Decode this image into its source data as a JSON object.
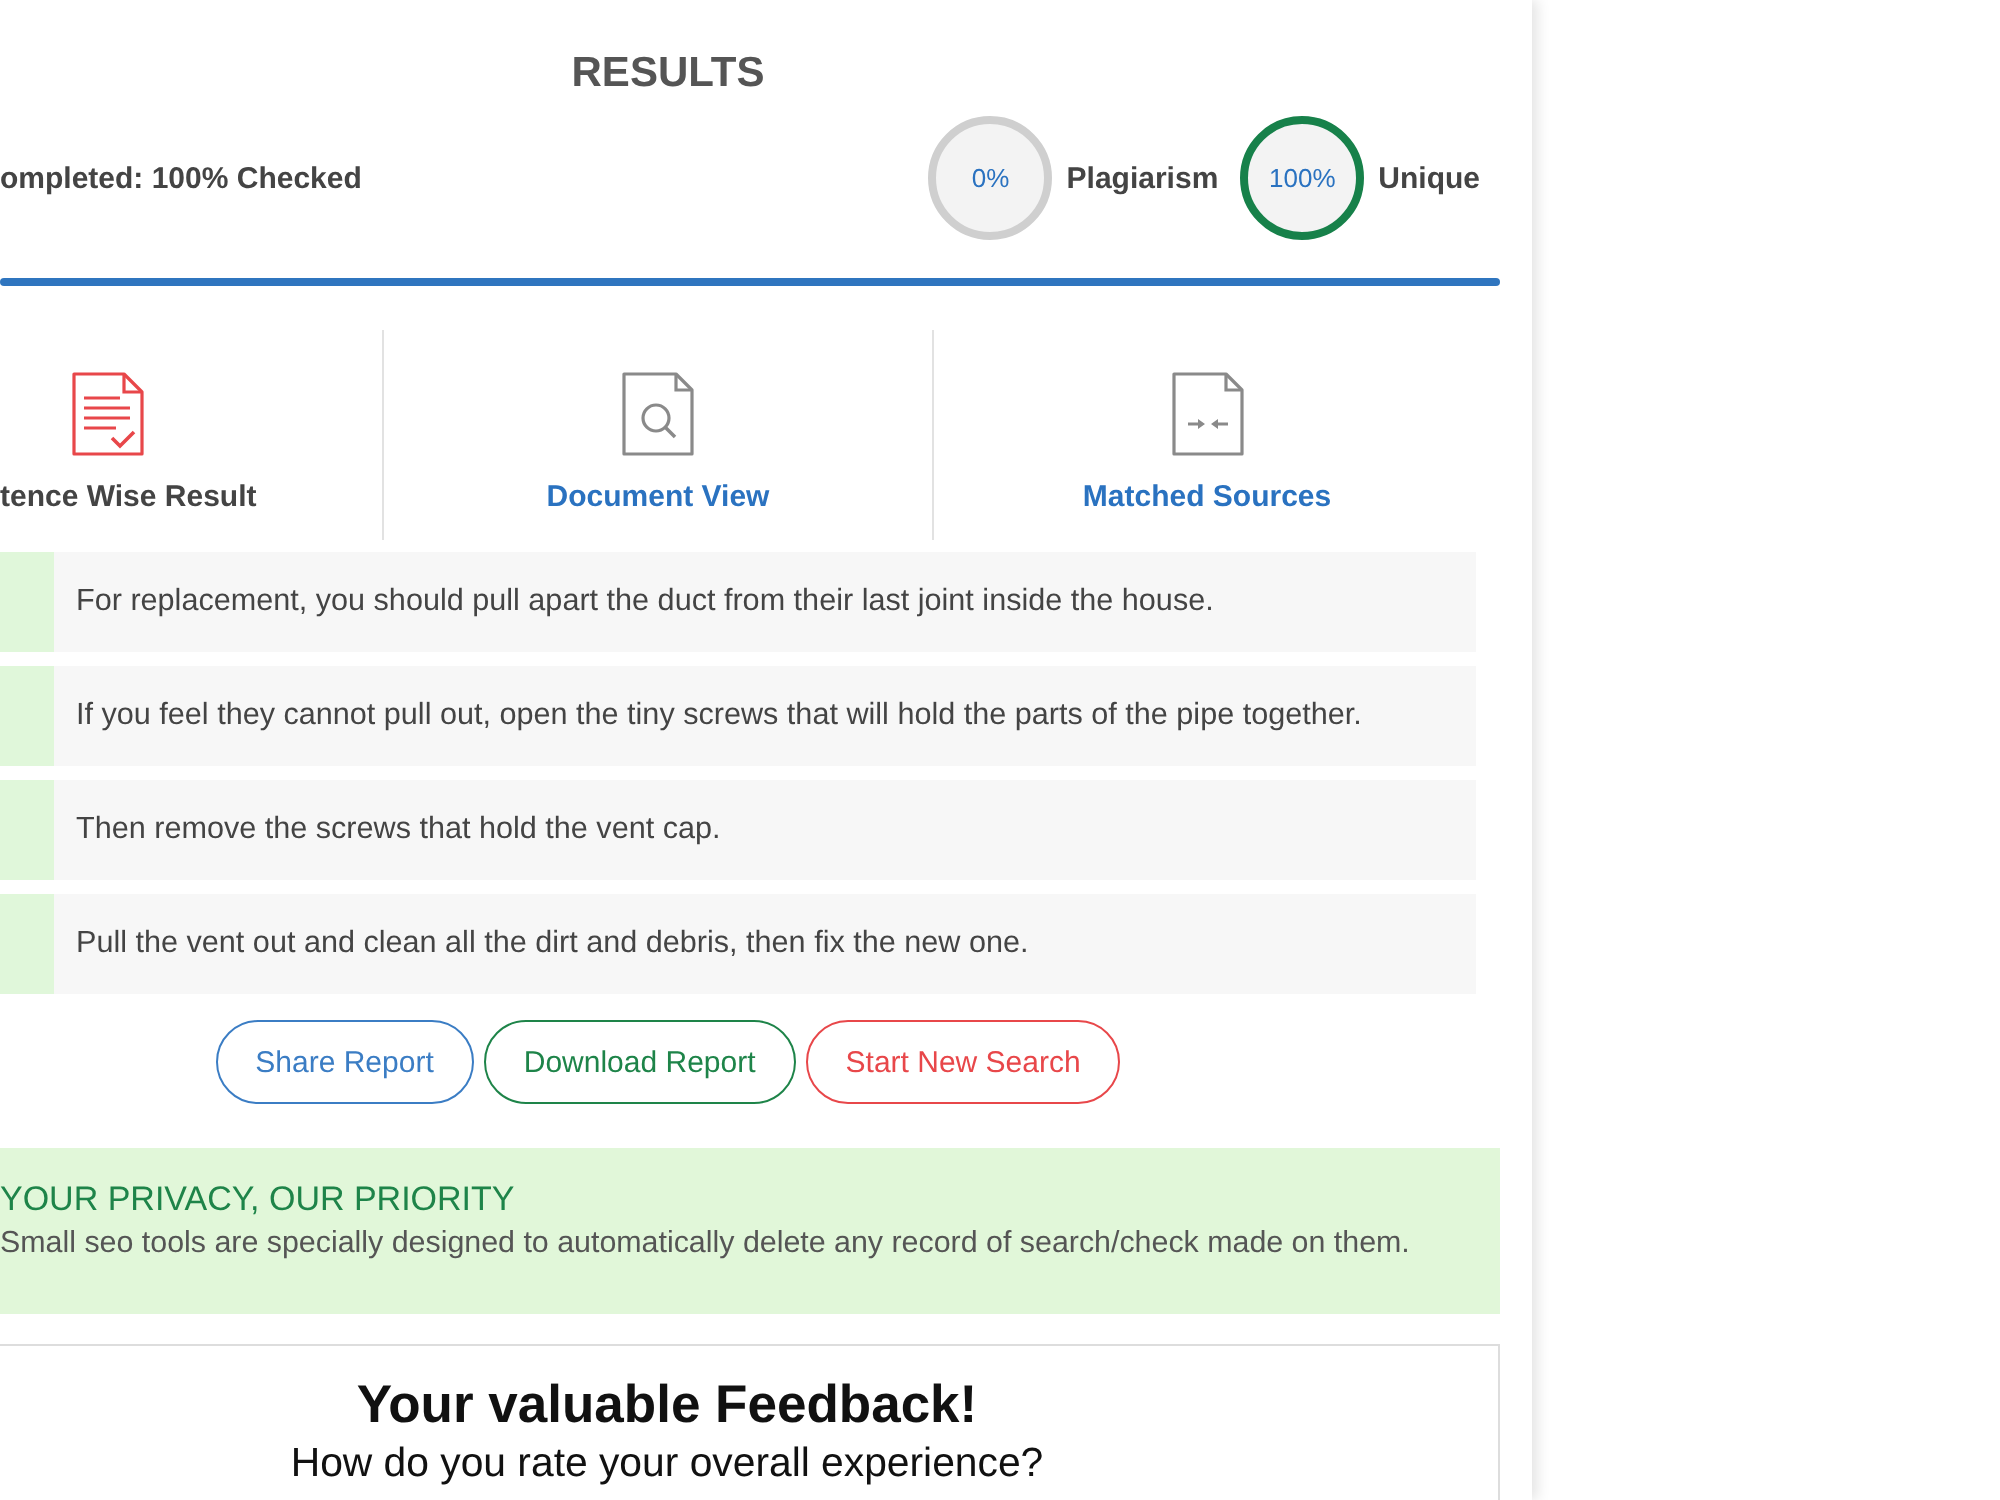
{
  "header": {
    "title": "RESULTS",
    "status": "ompleted: 100% Checked"
  },
  "meters": [
    {
      "kind": "plagiarism",
      "reading": "0%",
      "label": "Plagiarism"
    },
    {
      "kind": "unique",
      "reading": "100%",
      "label": "Unique"
    }
  ],
  "tabs": [
    {
      "kind": "sentences",
      "label": "tence Wise Result",
      "selected": true
    },
    {
      "kind": "document",
      "label": "Document View",
      "selected": false
    },
    {
      "kind": "sources",
      "label": "Matched Sources",
      "selected": false
    }
  ],
  "sentences": [
    {
      "text": "For replacement, you should pull apart the duct from their last joint inside the house.",
      "plagiarized": false
    },
    {
      "text": "If you feel they cannot pull out, open the tiny screws that will hold the parts of the pipe together.",
      "plagiarized": false
    },
    {
      "text": "Then remove the screws that hold the vent cap.",
      "plagiarized": false
    },
    {
      "text": "Pull the vent out and clean all the dirt and debris, then fix the new one.",
      "plagiarized": false
    }
  ],
  "buttons": [
    {
      "label": "Share Report",
      "color": "#3b7dc4"
    },
    {
      "label": "Download Report",
      "color": "#1e8449"
    },
    {
      "label": "Start New Search",
      "color": "#e8474a"
    }
  ],
  "privacy": {
    "title": "YOUR PRIVACY, OUR PRIORITY",
    "text": "Small seo tools are specially designed to automatically delete any record of search/check made on them."
  },
  "feedback": {
    "title": "Your valuable Feedback!",
    "question": "How do you rate your overall experience?"
  }
}
